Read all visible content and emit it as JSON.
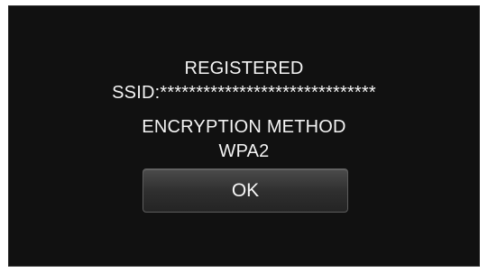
{
  "dialog": {
    "registered_text": "REGISTERED",
    "ssid_text": "SSID:******************************",
    "encryption_label": "ENCRYPTION METHOD",
    "encryption_value": "WPA2"
  },
  "buttons": {
    "ok_label": "OK"
  },
  "colors": {
    "screen_background": "#111111",
    "text": "#f4f4f4",
    "button_background": "#343434",
    "button_border": "#5d5d5d"
  }
}
